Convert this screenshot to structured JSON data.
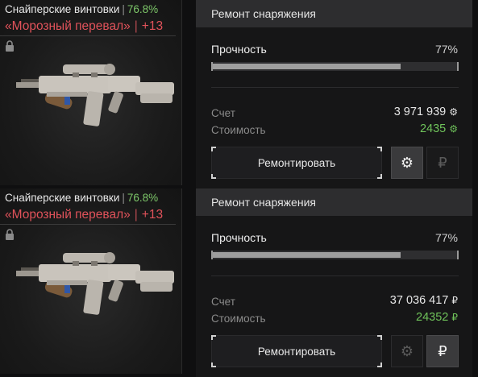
{
  "rows": [
    {
      "weapon": {
        "category": "Снайперские винтовки",
        "category_pct": "76.8%",
        "name": "«Морозный перевал»",
        "level": "+13"
      },
      "panel": {
        "title": "Ремонт снаряжения",
        "durability_label": "Прочность",
        "durability_value": "77%",
        "durability_fraction": 0.77,
        "account_label": "Счет",
        "account_value": "3 971 939",
        "cost_label": "Стоимость",
        "cost_value": "2435",
        "currency_icon": "gear-coin-icon",
        "repair_label": "Ремонтировать",
        "active_currency": "gear",
        "rub_symbol": "₽"
      }
    },
    {
      "weapon": {
        "category": "Снайперские винтовки",
        "category_pct": "76.8%",
        "name": "«Морозный перевал»",
        "level": "+13"
      },
      "panel": {
        "title": "Ремонт снаряжения",
        "durability_label": "Прочность",
        "durability_value": "77%",
        "durability_fraction": 0.77,
        "account_label": "Счет",
        "account_value": "37 036 417",
        "cost_label": "Стоимость",
        "cost_value": "24352",
        "currency_icon": "ruble-icon",
        "currency_symbol": "₽",
        "repair_label": "Ремонтировать",
        "active_currency": "rub",
        "rub_symbol": "₽"
      }
    }
  ],
  "colors": {
    "percent_green": "#7ec86a",
    "name_red": "#e0525a",
    "cost_green": "#6fc25a"
  }
}
